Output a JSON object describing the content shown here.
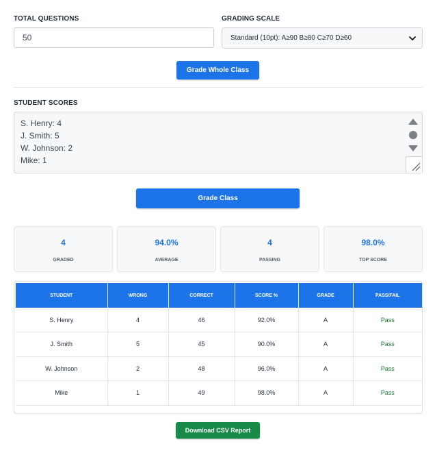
{
  "form": {
    "total_questions_label": "TOTAL QUESTIONS",
    "total_questions_value": "50",
    "grading_scale_label": "GRADING SCALE",
    "grading_scale_selected": "Standard (10pt): A≥90 B≥80 C≥70 D≥60",
    "grade_whole_class_button": "Grade Whole Class",
    "student_scores_label": "STUDENT SCORES",
    "student_scores_lines": [
      "S. Henry: 4",
      "J. Smith: 5",
      "W. Johnson: 2",
      "Mike: 1"
    ],
    "grade_class_button": "Grade Class"
  },
  "stats": [
    {
      "value": "4",
      "label": "GRADED"
    },
    {
      "value": "94.0%",
      "label": "AVERAGE"
    },
    {
      "value": "4",
      "label": "PASSING"
    },
    {
      "value": "98.0%",
      "label": "TOP SCORE"
    }
  ],
  "table": {
    "headers": [
      "STUDENT",
      "WRONG",
      "CORRECT",
      "SCORE %",
      "GRADE",
      "PASS/FAIL"
    ],
    "rows": [
      [
        "S. Henry",
        "4",
        "46",
        "92.0%",
        "A",
        "Pass"
      ],
      [
        "J. Smith",
        "5",
        "45",
        "90.0%",
        "A",
        "Pass"
      ],
      [
        "W. Johnson",
        "2",
        "48",
        "96.0%",
        "A",
        "Pass"
      ],
      [
        "Mike",
        "1",
        "49",
        "98.0%",
        "A",
        "Pass"
      ]
    ]
  },
  "download_button": "Download CSV Report",
  "colors": {
    "primary": "#1d73e8",
    "success": "#178a48",
    "pass_text": "#1a7a35"
  },
  "icons": {
    "select": "chevron-down-icon",
    "scroll_up": "triangle-up-icon",
    "scroll_down": "triangle-down-icon",
    "resize": "resize-grip-icon"
  }
}
